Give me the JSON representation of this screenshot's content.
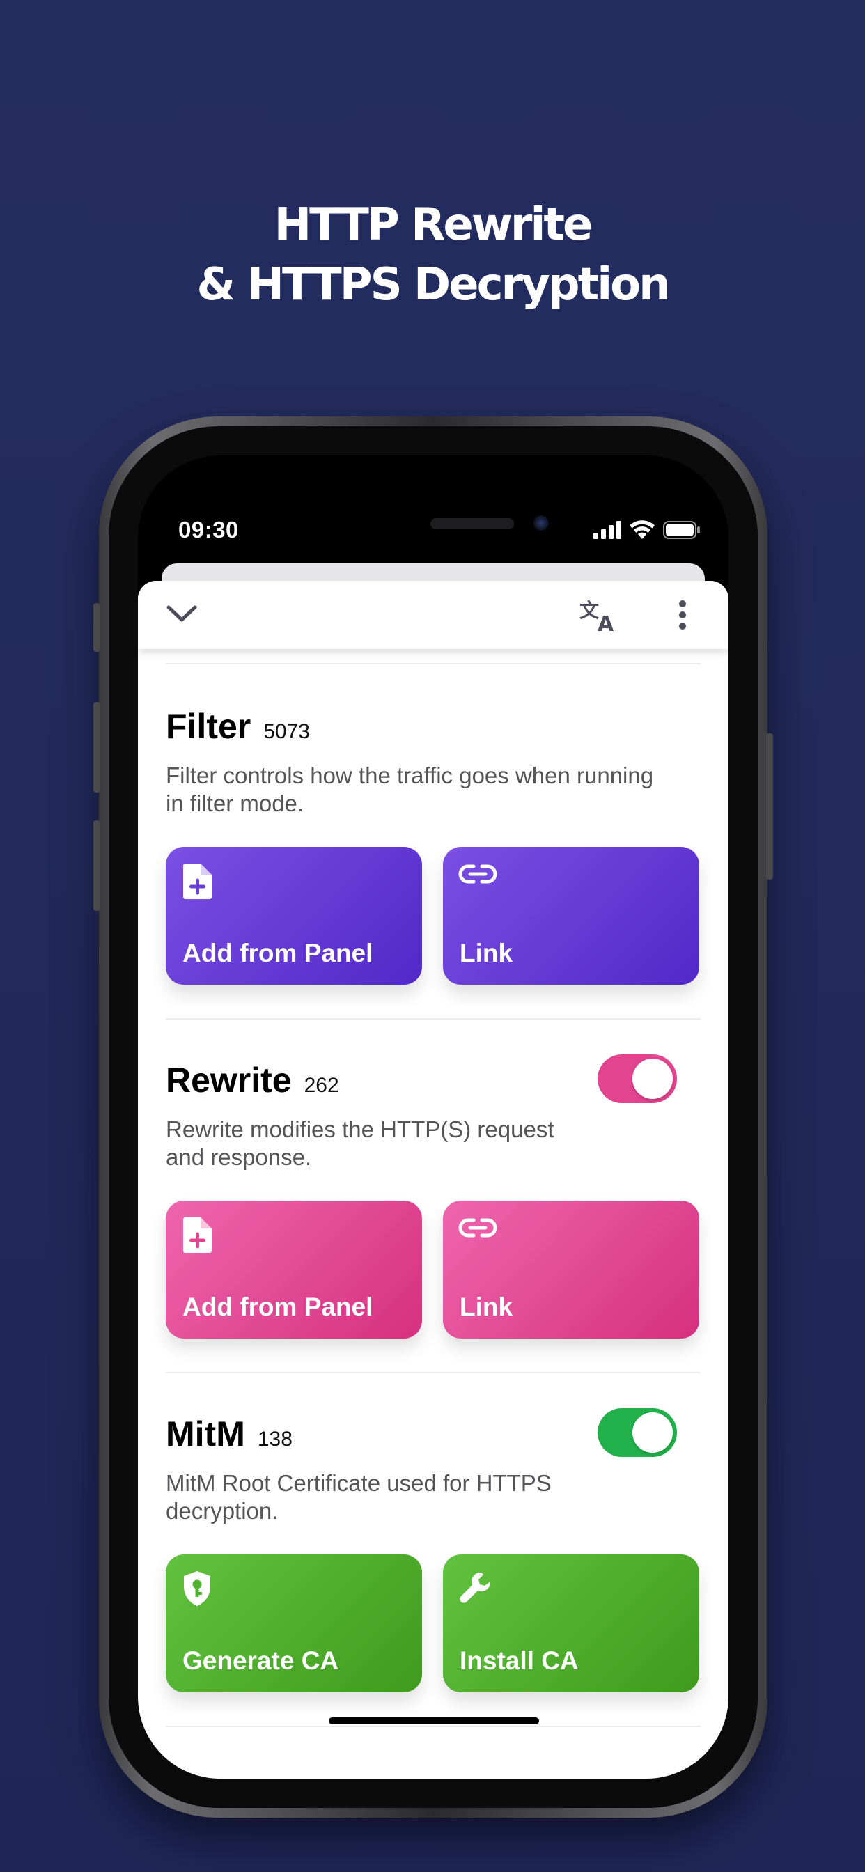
{
  "headline": {
    "line1": "HTTP Rewrite",
    "line2": "& HTTPS Decryption"
  },
  "status_bar": {
    "time": "09:30",
    "icons": [
      "signal-icon",
      "wifi-icon",
      "battery-icon"
    ]
  },
  "toolbar": {
    "icons": [
      "chevron-down-icon",
      "translate-icon",
      "more-vertical-icon"
    ]
  },
  "sections": {
    "filter": {
      "title": "Filter",
      "count": "5073",
      "description_line1": "Filter controls how the traffic goes when running",
      "description_line2": "in filter mode.",
      "color": "#6a3fd9",
      "buttons": [
        {
          "label": "Add from Panel",
          "icon": "file-add-icon"
        },
        {
          "label": "Link",
          "icon": "link-icon"
        }
      ]
    },
    "rewrite": {
      "title": "Rewrite",
      "count": "262",
      "description_line1": "Rewrite modifies the HTTP(S) request",
      "description_line2": "and response.",
      "toggle_on": true,
      "color": "#e2448f",
      "buttons": [
        {
          "label": "Add from Panel",
          "icon": "file-add-icon"
        },
        {
          "label": "Link",
          "icon": "link-icon"
        }
      ]
    },
    "mitm": {
      "title": "MitM",
      "count": "138",
      "description_line1": "MitM Root Certificate used for HTTPS",
      "description_line2": "decryption.",
      "toggle_on": true,
      "color": "#22b04b",
      "buttons": [
        {
          "label": "Generate CA",
          "icon": "shield-key-icon"
        },
        {
          "label": "Install CA",
          "icon": "wrench-icon"
        }
      ]
    }
  }
}
